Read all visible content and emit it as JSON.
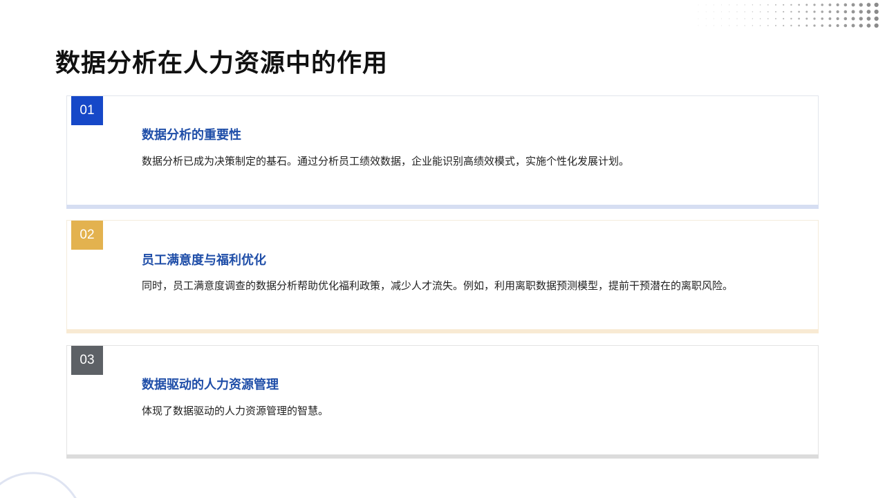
{
  "page": {
    "title": "数据分析在人力资源中的作用"
  },
  "cards": [
    {
      "number": "01",
      "title": "数据分析的重要性",
      "body": "数据分析已成为决策制定的基石。通过分析员工绩效数据，企业能识别高绩效模式，实施个性化发展计划。",
      "badge_color": "#1648c8",
      "bar_color": "#d6def2",
      "border_color": "#e2e5ec"
    },
    {
      "number": "02",
      "title": "员工满意度与福利优化",
      "body": "同时，员工满意度调查的数据分析帮助优化福利政策，减少人才流失。例如，利用离职数据预测模型，提前干预潜在的离职风险。",
      "badge_color": "#e3b24f",
      "bar_color": "#f8ead3",
      "border_color": "#f4ecdc"
    },
    {
      "number": "03",
      "title": "数据驱动的人力资源管理",
      "body": "体现了数据驱动的人力资源管理的智慧。",
      "badge_color": "#5d6166",
      "bar_color": "#dcdcdc",
      "border_color": "#e3e3e3"
    }
  ],
  "decorations": {
    "dot_grid": "dot-grid-icon",
    "corner_arc": "arc-decoration-icon",
    "dot_color": "#8a8a8a",
    "arc_color": "#dfe4f2"
  }
}
